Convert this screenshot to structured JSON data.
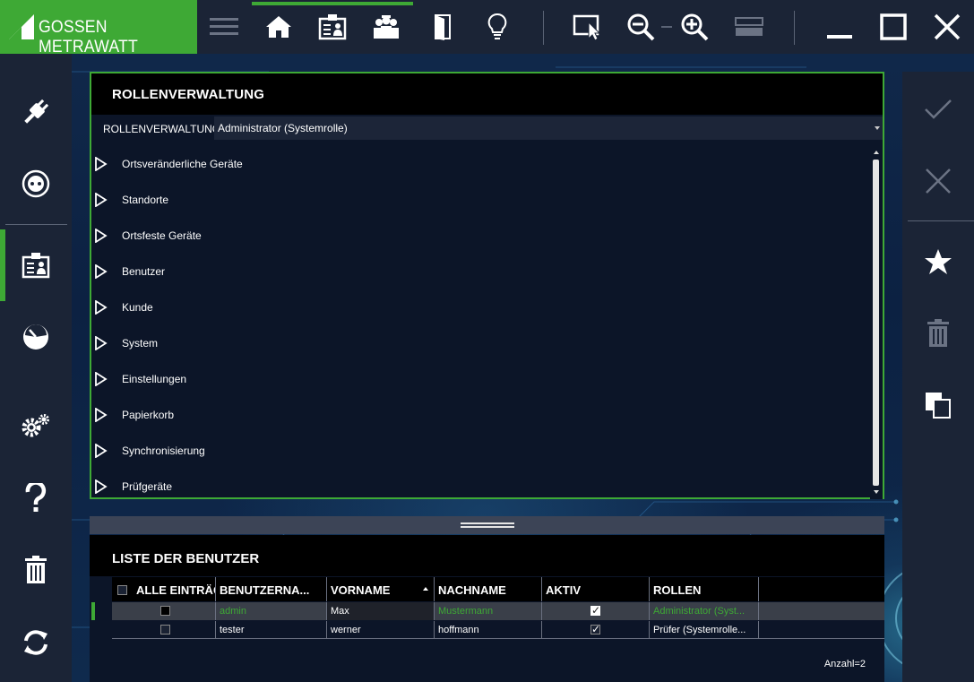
{
  "brand": {
    "name": "GOSSEN METRAWATT",
    "color": "#3ea935"
  },
  "topbar": {
    "icons": [
      "menu-icon",
      "home-icon",
      "user-card-icon",
      "group-icon",
      "door-icon",
      "lightbulb-icon",
      "pointer-select-icon",
      "zoom-out-icon",
      "zoom-in-icon",
      "layout-icon",
      "minimize-icon",
      "maximize-icon",
      "close-icon"
    ]
  },
  "leftbar": {
    "icons": [
      "plug-icon",
      "socket-icon",
      "user-card-icon",
      "gauge-icon",
      "settings-icon",
      "help-icon",
      "trash-icon",
      "sync-icon"
    ]
  },
  "rightbar": {
    "icons": [
      "check-icon",
      "cancel-icon",
      "star-icon",
      "delete-icon",
      "copy-icon"
    ]
  },
  "roles": {
    "title": "ROLLENVERWALTUNG",
    "select_label": "ROLLENVERWALTUNG",
    "selected_role": "Administrator (Systemrolle)",
    "items": [
      "Ortsveränderliche Geräte",
      "Standorte",
      "Ortsfeste Geräte",
      "Benutzer",
      "Kunde",
      "System",
      "Einstellungen",
      "Papierkorb",
      "Synchronisierung",
      "Prüfgeräte"
    ]
  },
  "users": {
    "title": "LISTE DER BENUTZER",
    "columns": [
      "ALLE EINTRÄGE",
      "BENUTZERNA...",
      "VORNAME",
      "NACHNAME",
      "AKTIV",
      "ROLLEN"
    ],
    "rows": [
      {
        "username": "admin",
        "firstname": "Max",
        "lastname": "Mustermann",
        "active": true,
        "roles": "Administrator (Syst..."
      },
      {
        "username": "tester",
        "firstname": "werner",
        "lastname": "hoffmann",
        "active": true,
        "roles": "Prüfer (Systemrolle..."
      }
    ],
    "count": "Anzahl=2"
  }
}
